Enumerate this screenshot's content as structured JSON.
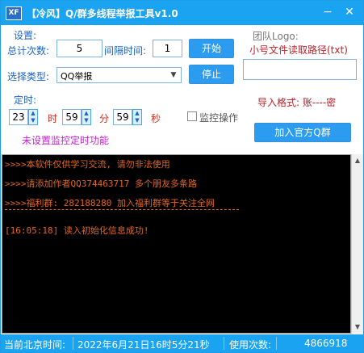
{
  "window": {
    "title": "【冷风】Q/群多线程举报工具v1.0",
    "logo_text": "XF",
    "minimize": "−",
    "close": "✕"
  },
  "settings": {
    "group_label": "设置:",
    "total_label": "总计次数:",
    "total_value": "5",
    "interval_label": "间隔时间:",
    "interval_value": "1",
    "start_button": "开始",
    "type_label": "选择类型:",
    "type_value": "QQ举报",
    "stop_button": "停止"
  },
  "timer": {
    "group_label": "定时:",
    "hour_value": "23",
    "hour_unit": "时",
    "minute_value": "59",
    "minute_unit": "分",
    "second_value": "59",
    "second_unit": "秒",
    "monitor_label": "监控操作",
    "monitor_checked": false,
    "status_text": "未设置监控定时功能"
  },
  "team": {
    "group_label": "团队Logo:",
    "path_hint": "小号文件读取路径(txt)",
    "path_value": "",
    "format_hint": "导入格式: 账----密",
    "join_button": "加入官方Q群"
  },
  "console": {
    "lines": [
      ">>>>本软件仅供学习交流, 请勿非法使用",
      ">>>>请添加作者QQ374463717 多个朋友多条路",
      ">>>>福利群: 282188280 加入福利群等于关注全网",
      "[16:05:18]  读入初始化信息成功!"
    ]
  },
  "status_bar": {
    "time_label": "当前北京时间:",
    "time_value": "2022年6月21日16时5分21秒",
    "count_label": "使用次数:",
    "count_value": "4866918"
  },
  "colors": {
    "accent": "#1aa3f1",
    "console_text": "#e5651e",
    "label_blue": "#1a63c8",
    "unit_red": "#d8291a",
    "warn_purple": "#c81fd1"
  }
}
